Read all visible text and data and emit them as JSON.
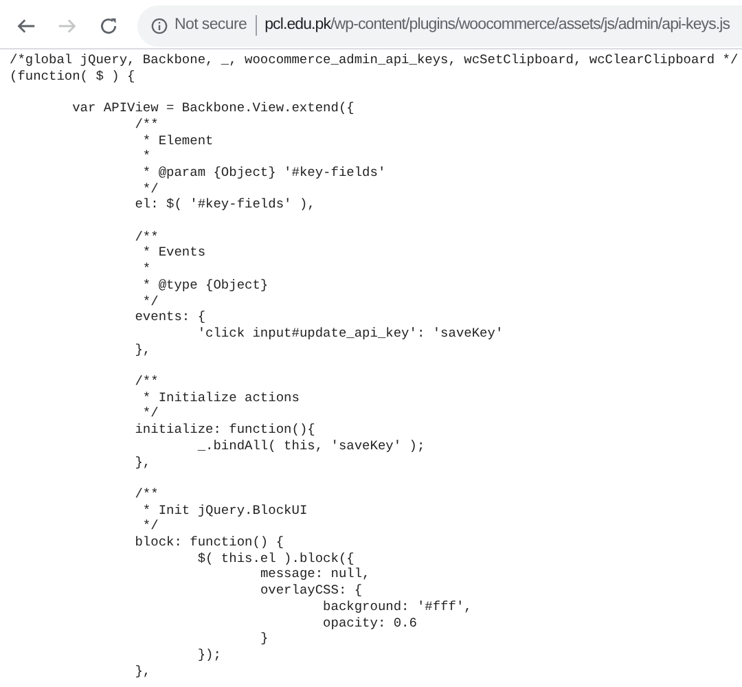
{
  "toolbar": {
    "security_label": "Not secure",
    "url_host": "pcl.edu.pk",
    "url_path": "/wp-content/plugins/woocommerce/assets/js/admin/api-keys.js"
  },
  "code": {
    "blocks": [
      [
        "/*global jQuery, Backbone, _, woocommerce_admin_api_keys, wcSetClipboard, wcClearClipboard */",
        "(function( $ ) {"
      ],
      [
        "\tvar APIView = Backbone.View.extend({",
        "\t\t/**",
        "\t\t * Element",
        "\t\t *",
        "\t\t * @param {Object} '#key-fields'",
        "\t\t */",
        "\t\tel: $( '#key-fields' ),"
      ],
      [
        "\t\t/**",
        "\t\t * Events",
        "\t\t *",
        "\t\t * @type {Object}",
        "\t\t */",
        "\t\tevents: {",
        "\t\t\t'click input#update_api_key': 'saveKey'",
        "\t\t},"
      ],
      [
        "\t\t/**",
        "\t\t * Initialize actions",
        "\t\t */",
        "\t\tinitialize: function(){",
        "\t\t\t_.bindAll( this, 'saveKey' );",
        "\t\t},"
      ],
      [
        "\t\t/**",
        "\t\t * Init jQuery.BlockUI",
        "\t\t */",
        "\t\tblock: function() {",
        "\t\t\t$( this.el ).block({",
        "\t\t\t\tmessage: null,",
        "\t\t\t\toverlayCSS: {",
        "\t\t\t\t\tbackground: '#fff',",
        "\t\t\t\t\topacity: 0.6",
        "\t\t\t\t}",
        "\t\t\t});",
        "\t\t},"
      ]
    ]
  }
}
